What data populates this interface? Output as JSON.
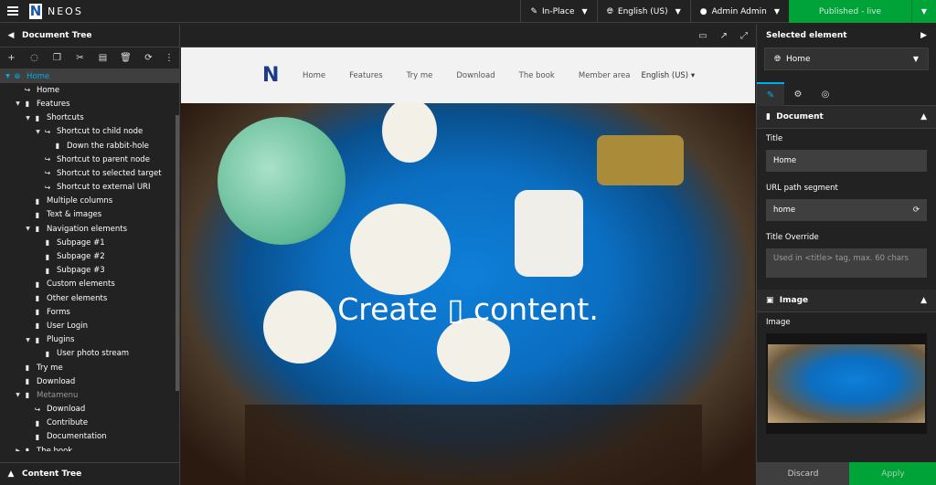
{
  "topbar": {
    "logo_text": "NEOS",
    "edit_mode": "In-Place",
    "language": "English (US)",
    "user": "Admin Admin",
    "publish_label": "Published - live"
  },
  "left_panel": {
    "title": "Document Tree",
    "content_tree_title": "Content Tree",
    "tree": [
      {
        "label": "Home",
        "level": 0,
        "toggle": "▼",
        "icon": "globe",
        "active": true
      },
      {
        "label": "Home",
        "level": 1,
        "toggle": "",
        "icon": "shortcut"
      },
      {
        "label": "Features",
        "level": 1,
        "toggle": "▼",
        "icon": "page"
      },
      {
        "label": "Shortcuts",
        "level": 2,
        "toggle": "▼",
        "icon": "page"
      },
      {
        "label": "Shortcut to child node",
        "level": 3,
        "toggle": "▼",
        "icon": "shortcut"
      },
      {
        "label": "Down the rabbit-hole",
        "level": 4,
        "toggle": "",
        "icon": "page"
      },
      {
        "label": "Shortcut to parent node",
        "level": 3,
        "toggle": "",
        "icon": "shortcut"
      },
      {
        "label": "Shortcut to selected target",
        "level": 3,
        "toggle": "",
        "icon": "shortcut"
      },
      {
        "label": "Shortcut to external URI",
        "level": 3,
        "toggle": "",
        "icon": "shortcut"
      },
      {
        "label": "Multiple columns",
        "level": 2,
        "toggle": "",
        "icon": "page"
      },
      {
        "label": "Text & images",
        "level": 2,
        "toggle": "",
        "icon": "page"
      },
      {
        "label": "Navigation elements",
        "level": 2,
        "toggle": "▼",
        "icon": "page"
      },
      {
        "label": "Subpage #1",
        "level": 3,
        "toggle": "",
        "icon": "page"
      },
      {
        "label": "Subpage #2",
        "level": 3,
        "toggle": "",
        "icon": "page"
      },
      {
        "label": "Subpage #3",
        "level": 3,
        "toggle": "",
        "icon": "page"
      },
      {
        "label": "Custom elements",
        "level": 2,
        "toggle": "",
        "icon": "page"
      },
      {
        "label": "Other elements",
        "level": 2,
        "toggle": "",
        "icon": "page"
      },
      {
        "label": "Forms",
        "level": 2,
        "toggle": "",
        "icon": "page"
      },
      {
        "label": "User Login",
        "level": 2,
        "toggle": "",
        "icon": "page"
      },
      {
        "label": "Plugins",
        "level": 2,
        "toggle": "▼",
        "icon": "page"
      },
      {
        "label": "User photo stream",
        "level": 3,
        "toggle": "",
        "icon": "page"
      },
      {
        "label": "Try me",
        "level": 1,
        "toggle": "",
        "icon": "page"
      },
      {
        "label": "Download",
        "level": 1,
        "toggle": "",
        "icon": "page"
      },
      {
        "label": "Metamenu",
        "level": 1,
        "toggle": "▼",
        "icon": "page",
        "muted": true
      },
      {
        "label": "Download",
        "level": 2,
        "toggle": "",
        "icon": "shortcut"
      },
      {
        "label": "Contribute",
        "level": 2,
        "toggle": "",
        "icon": "page"
      },
      {
        "label": "Documentation",
        "level": 2,
        "toggle": "",
        "icon": "page"
      },
      {
        "label": "The book",
        "level": 1,
        "toggle": "▶",
        "icon": "page"
      }
    ]
  },
  "site": {
    "nav": [
      "Home",
      "Features",
      "Try me",
      "Download",
      "The book",
      "Member area"
    ],
    "language": "English (US)",
    "hero_title": "Create ▯ content."
  },
  "inspector": {
    "title": "Selected element",
    "selected": "Home",
    "document_section": "Document",
    "title_label": "Title",
    "title_value": "Home",
    "url_label": "URL path segment",
    "url_value": "home",
    "override_label": "Title Override",
    "override_placeholder": "Used in <title> tag, max. 60 chars",
    "image_section": "Image",
    "image_label": "Image",
    "discard": "Discard",
    "apply": "Apply"
  },
  "colors": {
    "accent": "#00adee",
    "publish_green": "#00a338",
    "panel_bg": "#222222"
  }
}
